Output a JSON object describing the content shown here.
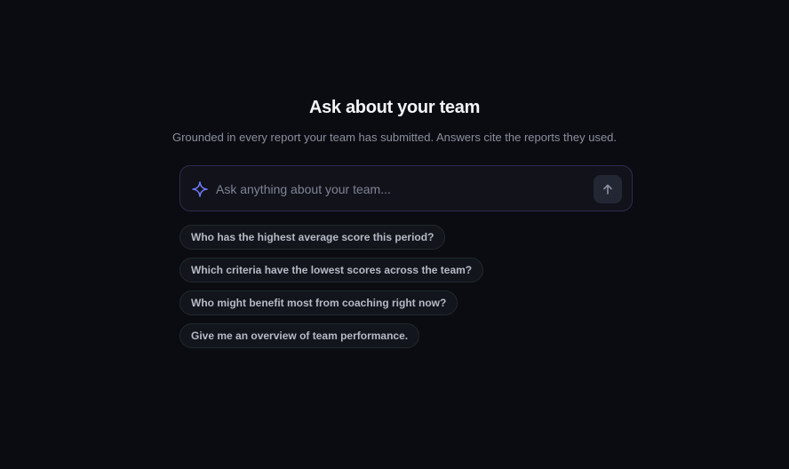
{
  "header": {
    "title": "Ask about your team",
    "subtitle": "Grounded in every report your team has submitted. Answers cite the reports they used."
  },
  "ask": {
    "placeholder": "Ask anything about your team...",
    "value": "",
    "icon": "sparkle-icon",
    "send_icon": "arrow-up-icon"
  },
  "suggestions": [
    "Who has the highest average score this period?",
    "Which criteria have the lowest scores across the team?",
    "Who might benefit most from coaching right now?",
    "Give me an overview of team performance."
  ],
  "colors": {
    "background": "#0b0c11",
    "accent": "#6f7bf7",
    "input_border": "#2e2b4f"
  }
}
